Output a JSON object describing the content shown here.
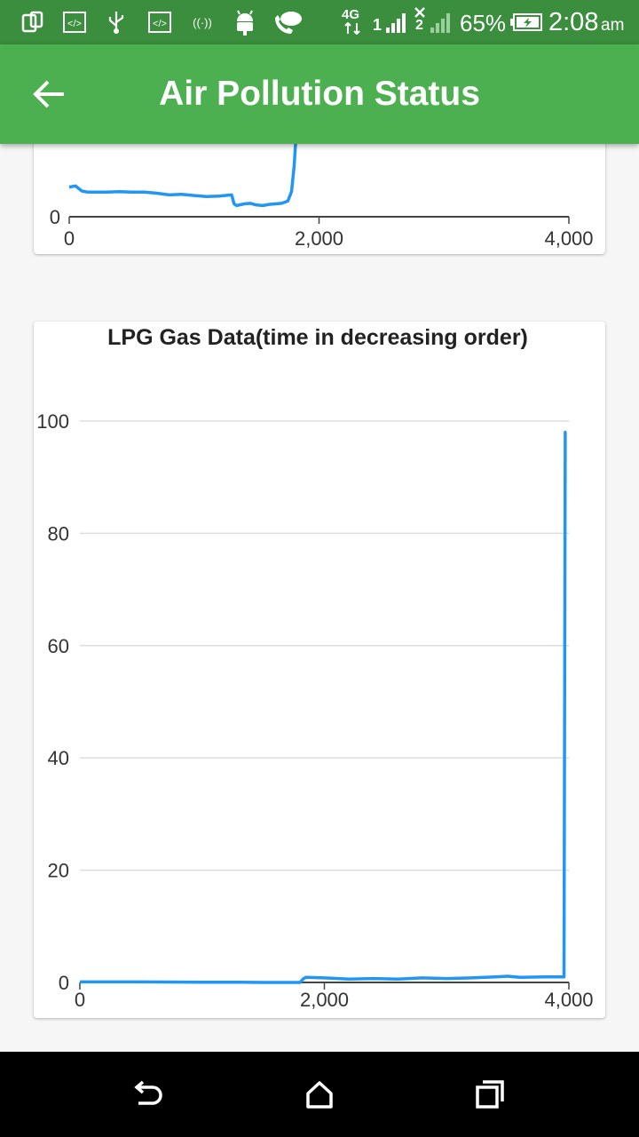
{
  "status_bar": {
    "network": "4G",
    "sim1": "1",
    "sim2": "2",
    "battery": "65%",
    "time": "2:08",
    "ampm": "am"
  },
  "app_bar": {
    "title": "Air Pollution Status",
    "color": "#4caf50"
  },
  "chart_data": [
    {
      "type": "line",
      "title": "",
      "x_ticks": [
        "0",
        "2,000",
        "4,000"
      ],
      "y_ticks": [
        "0"
      ],
      "xlim": [
        0,
        4000
      ],
      "color": "#2196f3",
      "x": [
        0,
        50,
        100,
        150,
        200,
        300,
        400,
        500,
        600,
        700,
        800,
        900,
        1000,
        1100,
        1200,
        1300,
        1320,
        1340,
        1400,
        1450,
        1500,
        1550,
        1600,
        1700,
        1750,
        1780,
        1800,
        1820
      ],
      "y": [
        5.3,
        5.5,
        4.6,
        4.4,
        4.4,
        4.4,
        4.5,
        4.4,
        4.4,
        4.2,
        3.9,
        4.0,
        3.8,
        3.6,
        3.7,
        3.9,
        2.3,
        2.0,
        2.3,
        2.4,
        2.1,
        2.0,
        2.2,
        2.4,
        2.8,
        4.5,
        9.0,
        16.0
      ]
    },
    {
      "type": "line",
      "title": "LPG Gas Data(time in decreasing order)",
      "x_ticks": [
        "0",
        "2,000",
        "4,000"
      ],
      "y_ticks": [
        "0",
        "20",
        "40",
        "60",
        "80",
        "100"
      ],
      "xlim": [
        0,
        4000
      ],
      "ylim": [
        0,
        100
      ],
      "grid": true,
      "color": "#2196f3",
      "x": [
        0,
        500,
        1000,
        1300,
        1500,
        1800,
        1830,
        1850,
        2000,
        2200,
        2400,
        2600,
        2800,
        3000,
        3200,
        3400,
        3500,
        3600,
        3800,
        3960,
        3970,
        3980
      ],
      "y": [
        0.1,
        0.1,
        0.05,
        0.05,
        0,
        0,
        0.7,
        0.9,
        0.8,
        0.6,
        0.7,
        0.6,
        0.8,
        0.7,
        0.8,
        1.0,
        1.1,
        0.9,
        1.0,
        1.0,
        98,
        98
      ]
    }
  ]
}
